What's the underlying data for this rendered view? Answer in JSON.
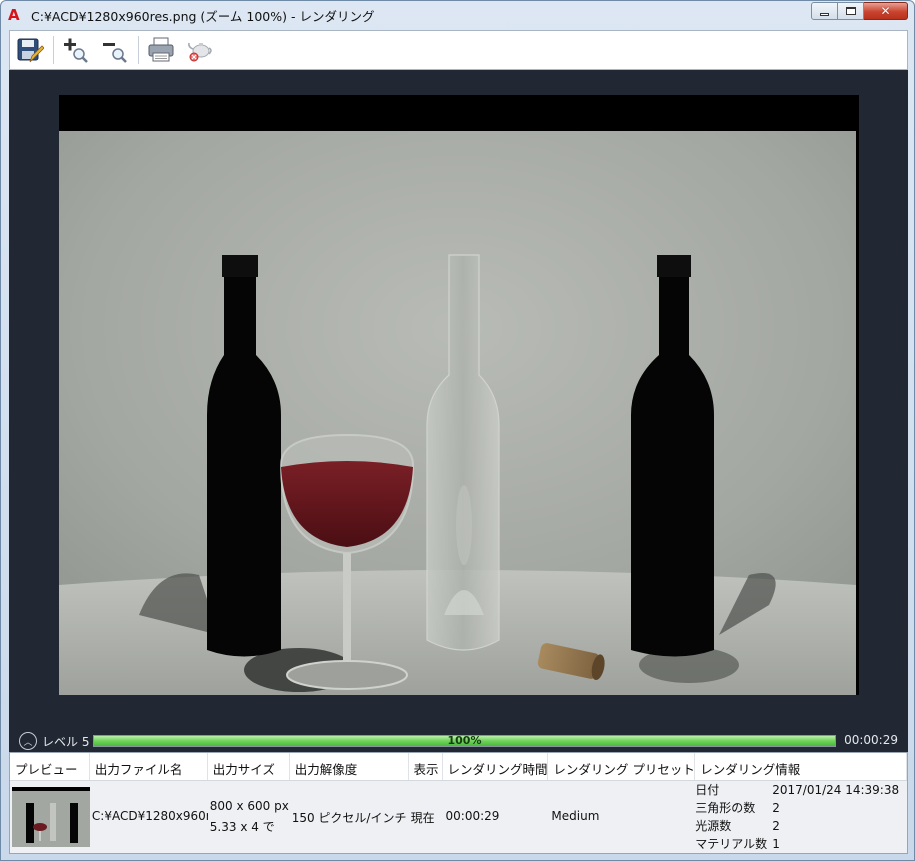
{
  "window": {
    "title": "C:¥ACD¥1280x960res.png (ズーム 100%) - レンダリング",
    "app_icon_letter": "A",
    "close_glyph": "✕"
  },
  "toolbar": {
    "buttons": [
      "save-icon",
      "zoom-in-icon",
      "zoom-out-icon",
      "print-icon",
      "render-teapot-icon"
    ]
  },
  "progress": {
    "level_label": "レベル 5",
    "percent_text": "100%",
    "percent": 100,
    "elapsed": "00:00:29"
  },
  "history": {
    "columns": [
      "プレビュー",
      "出力ファイル名",
      "出力サイズ",
      "出力解像度",
      "表示",
      "レンダリング時間",
      "レンダリング プリセット",
      "レンダリング情報"
    ],
    "row": {
      "file_name": "C:¥ACD¥1280x960r",
      "size_line1": "800 x 600 px",
      "size_line2": "5.33 x 4 で",
      "resolution": "150 ピクセル/インチ",
      "view": "現在",
      "render_time": "00:00:29",
      "preset": "Medium",
      "info": [
        {
          "key": "日付",
          "value": "2017/01/24 14:39:38"
        },
        {
          "key": "三角形の数",
          "value": "2"
        },
        {
          "key": "光源数",
          "value": "2"
        },
        {
          "key": "マテリアル数",
          "value": "1"
        }
      ]
    }
  },
  "colors": {
    "viewport_bg": "#212833",
    "progress_fill": "#5fc94c",
    "app_icon": "#d8141b"
  }
}
